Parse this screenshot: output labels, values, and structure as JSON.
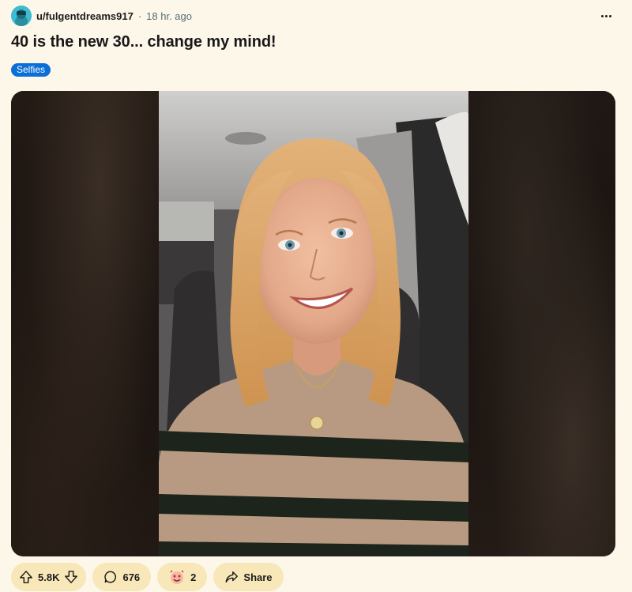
{
  "post": {
    "author": "u/fulgentdreams917",
    "separator": "·",
    "time_ago": "18 hr. ago",
    "title": "40 is the new 30... change my mind!",
    "flair": "Selfies",
    "flair_color": "#0a6fd6"
  },
  "actions": {
    "vote_count": "5.8K",
    "comment_count": "676",
    "award_count": "2",
    "share_label": "Share"
  },
  "colors": {
    "background": "#fdf7ea",
    "action_pill": "#f8e7b8",
    "avatar": "#3fbcd0"
  },
  "icons": [
    "more-horizontal-icon",
    "upvote-icon",
    "downvote-icon",
    "comment-icon",
    "award-icon",
    "share-icon"
  ]
}
